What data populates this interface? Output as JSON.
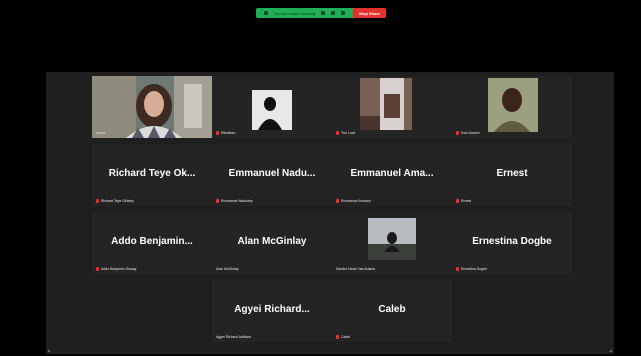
{
  "share_bar": {
    "text": "You are screen sharing",
    "stop_label": "Stop Share"
  },
  "participants": [
    {
      "display": "",
      "label": "Laura",
      "muted": false,
      "type": "video-laura"
    },
    {
      "display": "",
      "label": "Ellesteen",
      "muted": true,
      "type": "photo-silhouette"
    },
    {
      "display": "",
      "label": "The Lord",
      "muted": true,
      "type": "photo-room"
    },
    {
      "display": "",
      "label": "Kwo Ansere",
      "muted": true,
      "type": "photo-man"
    },
    {
      "display": "Richard Teye Ok...",
      "label": "Richard Teye Okleley",
      "muted": true
    },
    {
      "display": "Emmanuel Nadu...",
      "label": "Emmanuel Nadudey",
      "muted": true
    },
    {
      "display": "Emmanuel Ama...",
      "label": "Emmanuel Amanor",
      "muted": true
    },
    {
      "display": "Ernest",
      "label": "Ernest",
      "muted": true
    },
    {
      "display": "Addo Benjamin...",
      "label": "Addo Benjamin Dwaay",
      "muted": true
    },
    {
      "display": "Alan McGinlay",
      "label": "Alan McGinlay",
      "muted": false
    },
    {
      "display": "",
      "label": "Sandra Nana Yaa Adams",
      "muted": false,
      "type": "photo-field"
    },
    {
      "display": "Ernestina Dogbe",
      "label": "Ernestina Dogbe",
      "muted": true
    },
    {
      "display": "Agyei Richard...",
      "label": "Agyei Richard Addison",
      "muted": false
    },
    {
      "display": "Caleb",
      "label": "Caleb",
      "muted": true
    }
  ],
  "colors": {
    "active_speaker": "#c6d931",
    "muted": "#e5322d",
    "share_green": "#1fae55"
  }
}
